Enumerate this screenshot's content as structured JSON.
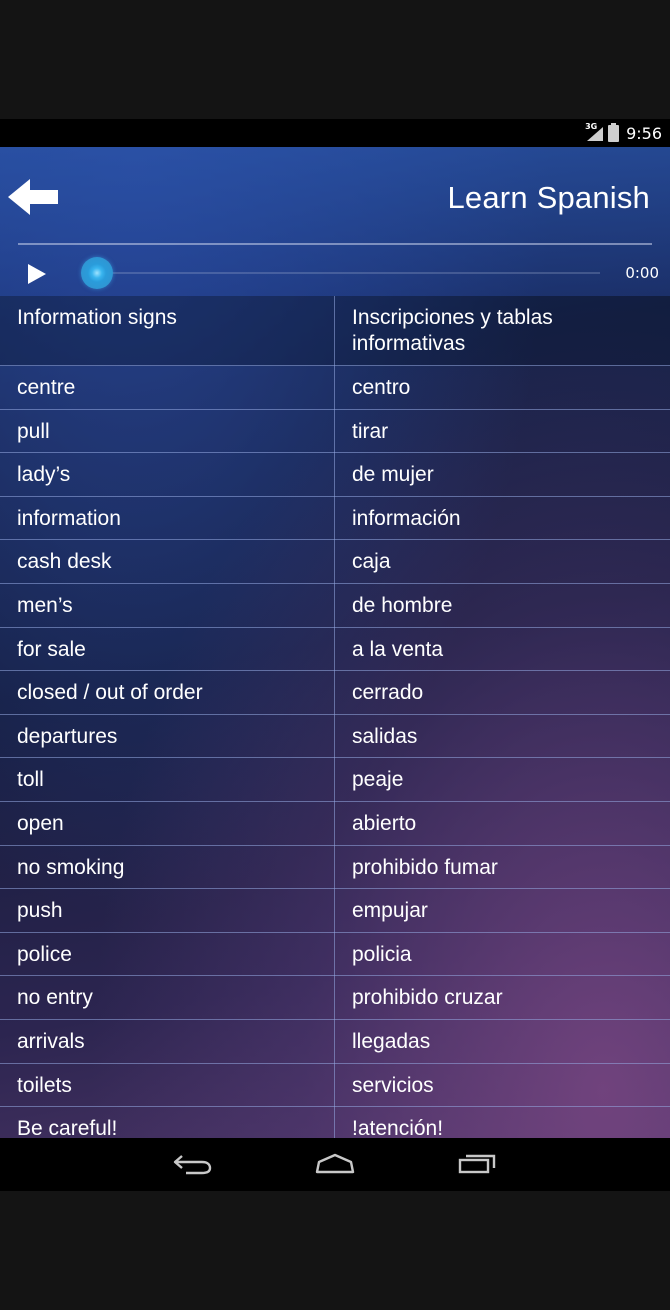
{
  "status_bar": {
    "network_label": "3G",
    "time": "9:56"
  },
  "header": {
    "title": "Learn Spanish",
    "back_icon": "back-arrow-icon",
    "play_icon": "play-icon",
    "playback_time": "0:00",
    "playback_progress": 0
  },
  "table": {
    "header": {
      "english": "Information signs",
      "spanish": "Inscripciones y tablas informativas"
    },
    "rows": [
      {
        "english": "centre",
        "spanish": "centro"
      },
      {
        "english": "pull",
        "spanish": "tirar"
      },
      {
        "english": "lady’s",
        "spanish": "de mujer"
      },
      {
        "english": "information",
        "spanish": "información"
      },
      {
        "english": "cash desk",
        "spanish": "caja"
      },
      {
        "english": "men’s",
        "spanish": "de hombre"
      },
      {
        "english": "for sale",
        "spanish": "a la venta"
      },
      {
        "english": "closed / out of order",
        "spanish": "cerrado"
      },
      {
        "english": "departures",
        "spanish": "salidas"
      },
      {
        "english": "toll",
        "spanish": "peaje"
      },
      {
        "english": "open",
        "spanish": "abierto"
      },
      {
        "english": "no smoking",
        "spanish": "prohibido fumar"
      },
      {
        "english": "push",
        "spanish": "empujar"
      },
      {
        "english": "police",
        "spanish": "policia"
      },
      {
        "english": "no entry",
        "spanish": "prohibido cruzar"
      },
      {
        "english": "arrivals",
        "spanish": "llegadas"
      },
      {
        "english": "toilets",
        "spanish": "servicios"
      },
      {
        "english": "Be careful!",
        "spanish": "!atención!"
      }
    ]
  },
  "nav_bar": {
    "back_icon": "nav-back-icon",
    "home_icon": "nav-home-icon",
    "recents_icon": "nav-recents-icon"
  },
  "colors": {
    "accent": "#2f96d3",
    "divider": "#96aae1",
    "text": "#ffffff"
  }
}
